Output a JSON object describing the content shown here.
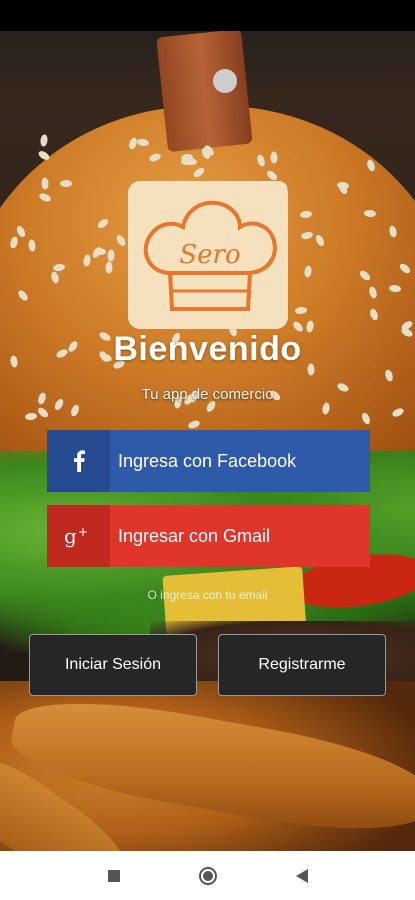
{
  "welcome": {
    "title": "Bienvenido",
    "subtitle": "Tu app de comercio",
    "logo_text": "Sero"
  },
  "social": {
    "facebook_label": "Ingresa con Facebook",
    "gmail_label": "Ingresar con Gmail",
    "facebook_icon": "facebook-icon",
    "gmail_icon": "google-plus-icon"
  },
  "divider_text": "O ingresa con tu email",
  "actions": {
    "login_label": "Iniciar Sesión",
    "register_label": "Registrarme"
  },
  "nav": {
    "recents_icon": "square-icon",
    "home_icon": "circle-icon",
    "back_icon": "triangle-back-icon"
  },
  "colors": {
    "facebook": "#2f5aa9",
    "gmail": "#e0352b",
    "logo_bg": "#f6e1be",
    "logo_accent": "#e8762c"
  }
}
